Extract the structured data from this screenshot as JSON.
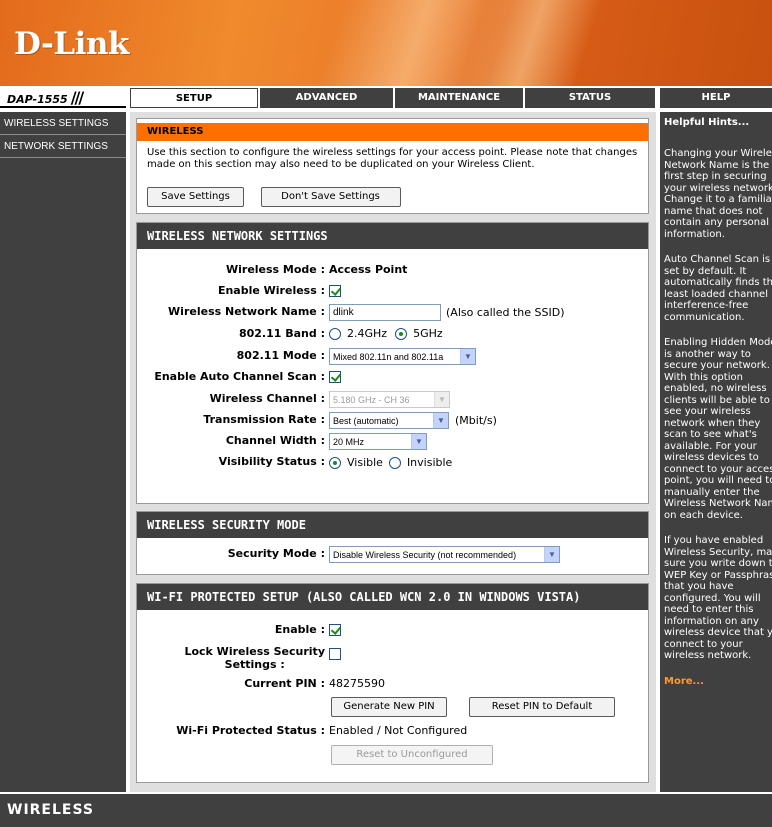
{
  "brand": {
    "logo_text": "D-Link",
    "model": "DAP-1555"
  },
  "tabs": [
    {
      "label": "SETUP",
      "active": true
    },
    {
      "label": "ADVANCED",
      "active": false
    },
    {
      "label": "MAINTENANCE",
      "active": false
    },
    {
      "label": "STATUS",
      "active": false
    },
    {
      "label": "HELP",
      "active": false
    }
  ],
  "sidebar": {
    "items": [
      {
        "label": "WIRELESS SETTINGS"
      },
      {
        "label": "NETWORK SETTINGS"
      }
    ]
  },
  "intro": {
    "title": "WIRELESS",
    "text": "Use this section to configure the wireless settings for your access point. Please note that changes made on this section may also need to be duplicated on your Wireless Client.",
    "save_label": "Save Settings",
    "dont_save_label": "Don't Save Settings"
  },
  "network": {
    "title": "WIRELESS NETWORK SETTINGS",
    "mode_label": "Wireless Mode :",
    "mode_value": "Access Point",
    "enable_label": "Enable Wireless :",
    "enable_checked": true,
    "ssid_label": "Wireless Network Name :",
    "ssid_value": "dlink",
    "ssid_note": "(Also called the SSID)",
    "band_label": "802.11 Band :",
    "band_options": [
      "2.4GHz",
      "5GHz"
    ],
    "band_selected": "5GHz",
    "mode80211_label": "802.11 Mode :",
    "mode80211_value": "Mixed 802.11n and 802.11a",
    "autoscan_label": "Enable Auto Channel Scan :",
    "autoscan_checked": true,
    "channel_label": "Wireless Channel :",
    "channel_value": "5.180 GHz - CH 36",
    "rate_label": "Transmission Rate :",
    "rate_value": "Best (automatic)",
    "rate_unit": "(Mbit/s)",
    "width_label": "Channel Width :",
    "width_value": "20 MHz",
    "visibility_label": "Visibility Status :",
    "visibility_options": [
      "Visible",
      "Invisible"
    ],
    "visibility_selected": "Visible"
  },
  "security": {
    "title": "WIRELESS SECURITY MODE",
    "mode_label": "Security Mode :",
    "mode_value": "Disable Wireless Security (not recommended)"
  },
  "wps": {
    "title": "WI-FI PROTECTED SETUP (ALSO CALLED WCN 2.0 IN WINDOWS VISTA)",
    "enable_label": "Enable :",
    "enable_checked": true,
    "lock_label_1": "Lock Wireless Security",
    "lock_label_2": "Settings :",
    "lock_checked": false,
    "pin_label": "Current PIN :",
    "pin_value": "48275590",
    "generate_label": "Generate New PIN",
    "reset_pin_label": "Reset PIN to Default",
    "status_label": "Wi-Fi Protected Status :",
    "status_value": "Enabled / Not Configured",
    "reset_unconf_label": "Reset to Unconfigured"
  },
  "help": {
    "title": "Helpful Hints...",
    "p1": "Changing your Wireless Network Name is the first step in securing your wireless network. Change it to a familiar name that does not contain any personal information.",
    "p2": "Auto Channel Scan is set by default. It automatically finds the least loaded channel interference-free communication.",
    "p3": "Enabling Hidden Mode is another way to secure your network. With this option enabled, no wireless clients will be able to see your wireless network when they scan to see what's available. For your wireless devices to connect to your access point, you will need to manually enter the Wireless Network Name on each device.",
    "p4": "If you have enabled Wireless Security, make sure you write down the WEP Key or Passphrase that you have configured. You will need to enter this information on any wireless device that you connect to your wireless network.",
    "more": "More..."
  },
  "footer": {
    "label": "WIRELESS"
  }
}
